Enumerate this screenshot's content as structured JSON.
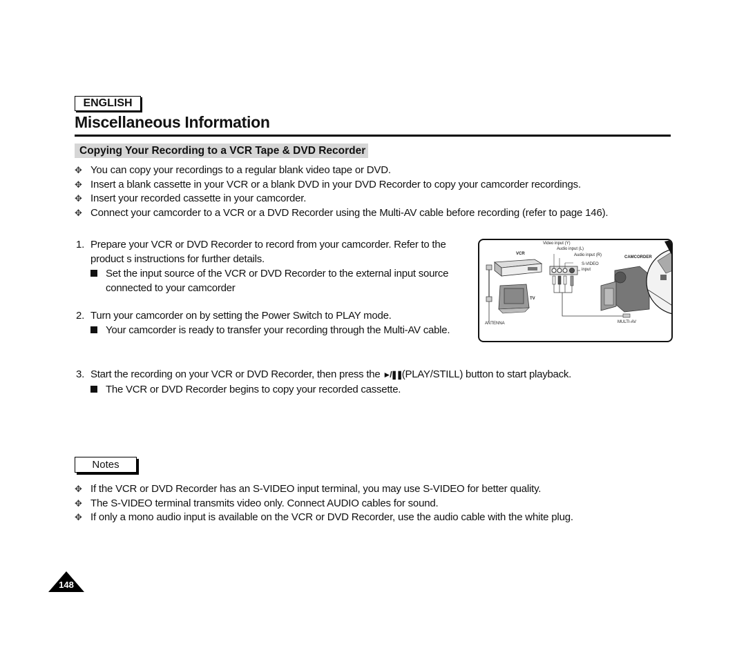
{
  "header": {
    "language": "ENGLISH",
    "title": "Miscellaneous Information"
  },
  "section": {
    "heading": "Copying Your Recording to a VCR Tape & DVD Recorder"
  },
  "intro_bullets": [
    "You can copy your recordings to a regular blank video tape or DVD.",
    "Insert a blank cassette in your VCR or a blank DVD in your DVD Recorder to copy your camcorder recordings.",
    "Insert your recorded cassette in your camcorder.",
    "Connect your camcorder to a VCR or a DVD Recorder using the Multi-AV cable before recording (refer to page 146)."
  ],
  "bullet_icon": "four-petal-diamond-icon",
  "steps": [
    {
      "number": "1.",
      "text_line1": "Prepare your VCR or DVD Recorder to record from your camcorder. Refer to the",
      "text_line2": "product s instructions for further details.",
      "sub_line1": "Set the input source of the VCR or DVD Recorder to the external input source",
      "sub_line2": "connected to your camcorder"
    },
    {
      "number": "2.",
      "text_line1": "Turn your camcorder on by setting the Power Switch to PLAY mode.",
      "sub_line1": "Your camcorder is ready to transfer your recording through the Multi-AV cable."
    },
    {
      "number": "3.",
      "text_before_icon": "Start the recording on your VCR or DVD Recorder, then press the",
      "icon": "play-pause-icon",
      "icon_glyph": "►/❚❚",
      "text_after_icon": "(PLAY/STILL) button to start playback.",
      "sub_line1": "The VCR or DVD Recorder begins to copy your recorded cassette."
    }
  ],
  "diagram": {
    "labels": {
      "video_input": "Video input (Y)",
      "audio_l": "Audio input (L)",
      "audio_r": "Audio input (R)",
      "svideo": "S-VIDEO",
      "svideo_input": "input",
      "vcr": "VCR",
      "tv": "TV",
      "camcorder": "CAMCORDER",
      "antenna": "ANTENNA",
      "multiav": "MULTI-AV"
    }
  },
  "notes": {
    "label": "Notes",
    "items": [
      "If the VCR or DVD Recorder has an S-VIDEO input terminal, you may use S-VIDEO for better quality.",
      "The S-VIDEO terminal transmits video only. Connect AUDIO cables for sound.",
      "If only a mono audio input is available on the VCR or DVD Recorder, use the audio cable with the white plug."
    ]
  },
  "footer": {
    "page_number": "148"
  }
}
